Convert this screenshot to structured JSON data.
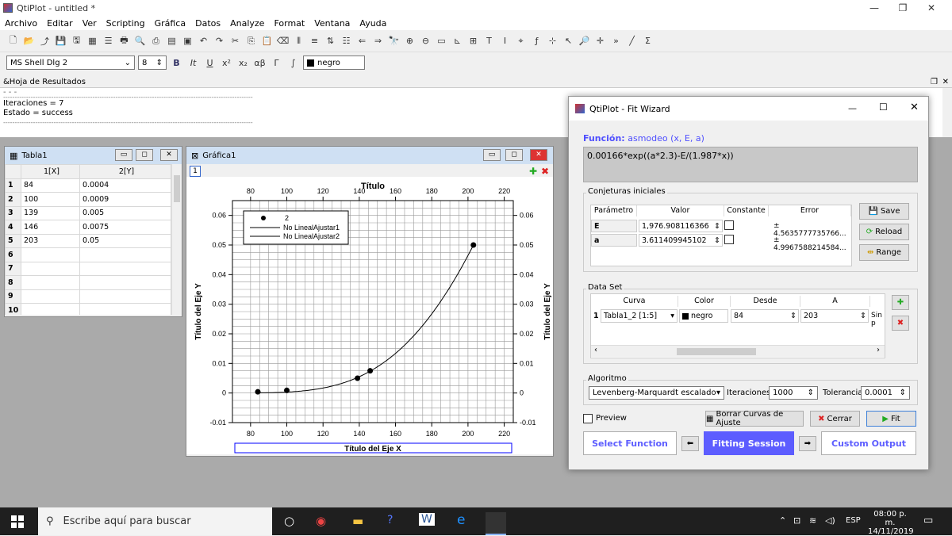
{
  "app": {
    "title": "QtiPlot - untitled *"
  },
  "menu": [
    "Archivo",
    "Editar",
    "Ver",
    "Scripting",
    "Gráfica",
    "Datos",
    "Analyze",
    "Format",
    "Ventana",
    "Ayuda"
  ],
  "format_bar": {
    "font": "MS Shell Dlg 2",
    "size": "8",
    "bold": "B",
    "italic": "It",
    "underline": "U",
    "superscript": "x²",
    "subscript": "x₂",
    "alpha": "αβ",
    "gamma": "Γ",
    "integral": "∫",
    "color": "negro"
  },
  "results": {
    "title": "&Hoja de Resultados",
    "lines": [
      "Iteraciones = 7",
      "Estado = success"
    ],
    "separator": "-------------------------------------------------------------------------------------------------------------"
  },
  "table_window": {
    "title": "Tabla1",
    "col1": "1[X]",
    "col2": "2[Y]",
    "rows": [
      [
        "1",
        "84",
        "0.0004"
      ],
      [
        "2",
        "100",
        "0.0009"
      ],
      [
        "3",
        "139",
        "0.005"
      ],
      [
        "4",
        "146",
        "0.0075"
      ],
      [
        "5",
        "203",
        "0.05"
      ],
      [
        "6",
        "",
        ""
      ],
      [
        "7",
        "",
        ""
      ],
      [
        "8",
        "",
        ""
      ],
      [
        "9",
        "",
        ""
      ],
      [
        "10",
        "",
        ""
      ]
    ]
  },
  "graph_window": {
    "title": "Gráfica1",
    "layer": "1"
  },
  "chart_data": {
    "type": "scatter",
    "title": "Título",
    "xlabel": "Título del Eje X",
    "ylabel": "Título del Eje Y",
    "ylabel_right": "Título del Eje Y",
    "xlim": [
      70,
      225
    ],
    "ylim": [
      -0.01,
      0.065
    ],
    "xticks": [
      "80",
      "100",
      "120",
      "140",
      "160",
      "180",
      "200",
      "220"
    ],
    "yticks": [
      "-0.01",
      "0",
      "0.01",
      "0.02",
      "0.03",
      "0.04",
      "0.05",
      "0.06"
    ],
    "legend": [
      "2",
      "No LinealAjustar1",
      "No LinealAjustar2"
    ],
    "legend_placement": "top-left",
    "grid": true,
    "series": [
      {
        "name": "2",
        "x": [
          84,
          100,
          139,
          146,
          203
        ],
        "y": [
          0.0004,
          0.0009,
          0.005,
          0.0075,
          0.05
        ]
      }
    ],
    "fit": {
      "a": 3.611409945102,
      "E": 1976.908116366
    }
  },
  "wizard": {
    "title": "QtiPlot - Fit Wizard",
    "function_label": "Función:",
    "function_name": "asmodeo (x, E, a)",
    "formula": "0.00166*exp((a*2.3)-E/(1.987*x))",
    "guesses_label": "Conjeturas iniciales",
    "param_headers": [
      "Parámetro",
      "Valor",
      "Constante",
      "Error"
    ],
    "params": [
      {
        "name": "E",
        "value": "1,976.908116366",
        "error": "± 4.5635777735766..."
      },
      {
        "name": "a",
        "value": "3.611409945102",
        "error": "± 4.9967588214584..."
      }
    ],
    "save": "Save",
    "reload": "Reload",
    "range": "Range",
    "dataset_label": "Data Set",
    "ds_headers": [
      "Curva",
      "Color",
      "Desde",
      "A"
    ],
    "ds_row": {
      "num": "1",
      "curve": "Tabla1_2 [1:5]",
      "color": "negro",
      "from": "84",
      "to": "203",
      "extra": "Sin p"
    },
    "algorithm_label": "Algoritmo",
    "algorithm": "Levenberg-Marquardt escalado",
    "iter_label": "Iteraciones",
    "iter": "1000",
    "tol_label": "Tolerancia",
    "tol": "0.0001",
    "preview": "Preview",
    "clear_fit": "Borrar Curvas de Ajuste",
    "close": "Cerrar",
    "fit": "Fit",
    "select_function": "Select Function",
    "fitting_session": "Fitting Session",
    "custom_output": "Custom Output"
  },
  "taskbar": {
    "search": "Escribe aquí para buscar",
    "lang": "ESP",
    "time": "08:00 p. m.",
    "date": "14/11/2019"
  },
  "colors": {
    "accent": "#4f4fff",
    "wizard_nav": "#5d5dff"
  }
}
